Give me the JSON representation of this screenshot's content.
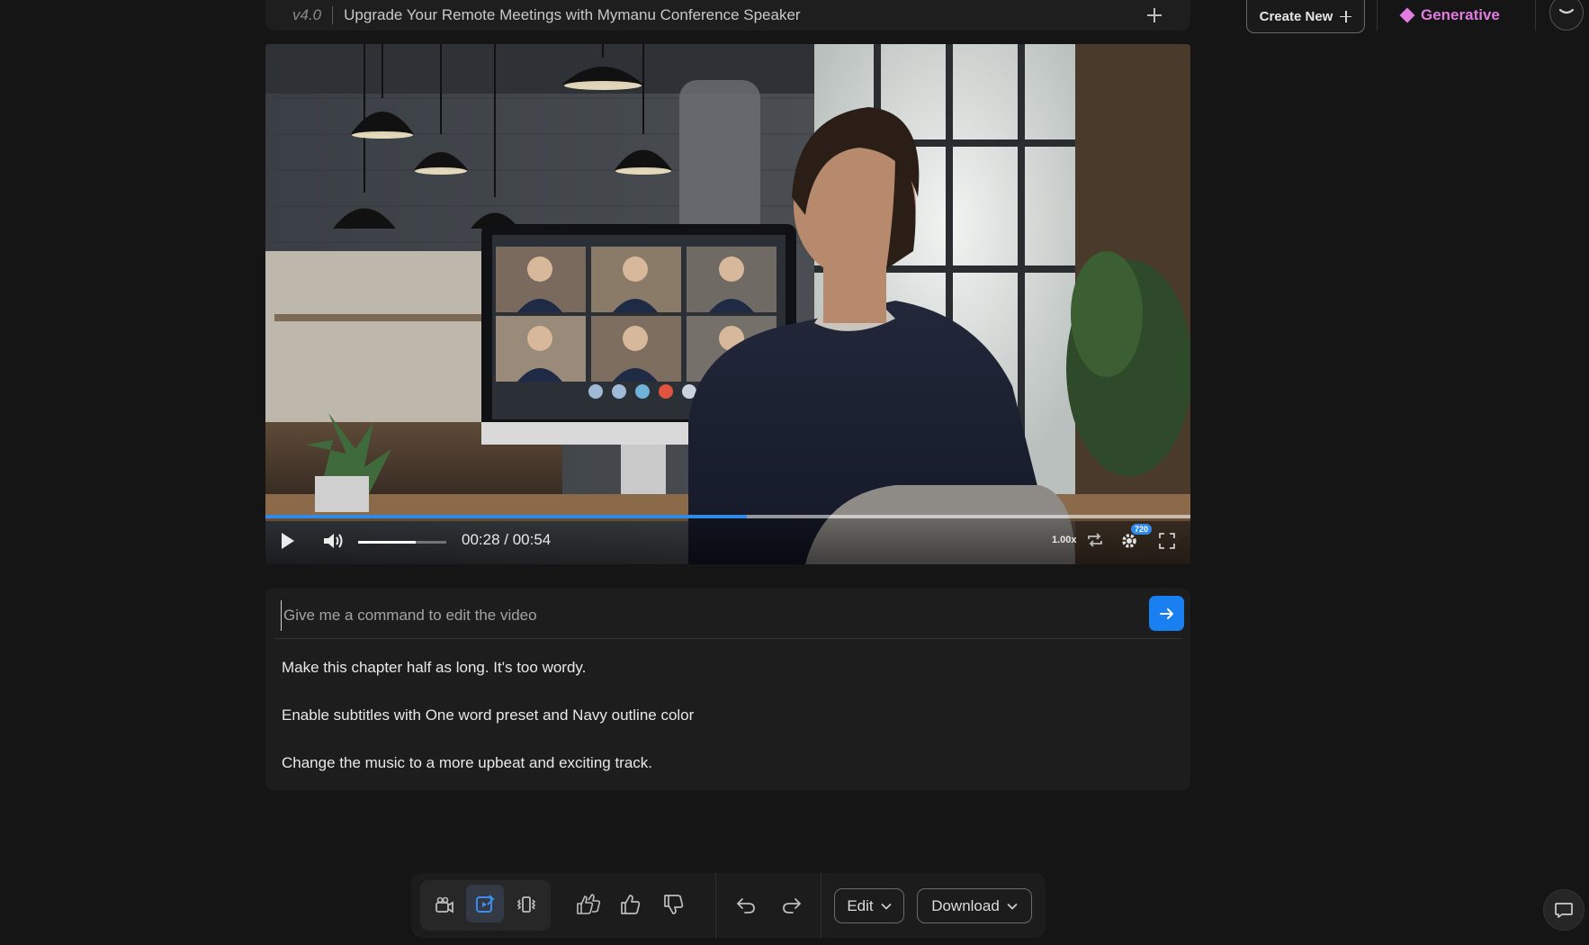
{
  "header": {
    "version": "v4.0",
    "project_title": "Upgrade Your Remote Meetings with Mymanu Conference Speaker",
    "create_new_label": "Create New",
    "generative_label": "Generative"
  },
  "player": {
    "current_time": "00:28",
    "duration": "00:54",
    "time_separator": " / ",
    "progress_fraction": 0.52,
    "volume_fraction": 0.65,
    "speed": "1.00x",
    "quality": "720"
  },
  "command": {
    "placeholder": "Give me a command to edit the video",
    "suggestions": [
      "Make this chapter half as long. It's too wordy.",
      "Enable subtitles with One word preset and Navy outline color",
      "Change the music to a more upbeat and exciting track."
    ]
  },
  "toolbar": {
    "edit_label": "Edit",
    "download_label": "Download",
    "icons": [
      "video-camera-icon",
      "edit-video-icon",
      "vibrate-icon",
      "double-thumbs-up-icon",
      "thumbs-up-icon",
      "thumbs-down-icon",
      "undo-icon",
      "redo-icon"
    ]
  },
  "colors": {
    "accent": "#1a7ff0",
    "generative": "#e27ce0",
    "background": "#151515"
  }
}
